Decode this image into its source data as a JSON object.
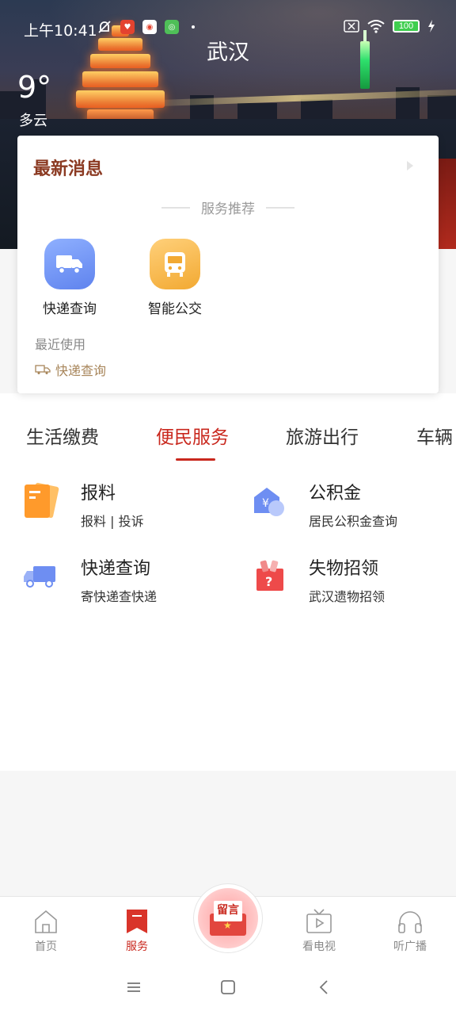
{
  "status_bar": {
    "time": "上午10:41",
    "battery": "100"
  },
  "header": {
    "city": "武汉",
    "temperature": "9°",
    "weather": "多云"
  },
  "news_card": {
    "title": "最新消息",
    "section_label": "服务推荐",
    "quick_services": [
      {
        "label": "快递查询",
        "icon": "truck-icon",
        "color": "#6f93f5"
      },
      {
        "label": "智能公交",
        "icon": "bus-icon",
        "color": "#f4b440"
      }
    ],
    "recent_label": "最近使用",
    "recent_item": "快递查询"
  },
  "tabs": [
    "生活缴费",
    "便民服务",
    "旅游出行",
    "车辆"
  ],
  "active_tab": "便民服务",
  "services": [
    {
      "name": "报料",
      "desc": "报料 | 投诉",
      "icon": "report-icon"
    },
    {
      "name": "公积金",
      "desc": "居民公积金查询",
      "icon": "housing-fund-icon"
    },
    {
      "name": "快递查询",
      "desc": "寄快递查快递",
      "icon": "truck-icon"
    },
    {
      "name": "失物招领",
      "desc": "武汉遗物招领",
      "icon": "lost-found-icon"
    }
  ],
  "bottom_nav": [
    {
      "label": "首页",
      "icon": "home-icon"
    },
    {
      "label": "服务",
      "icon": "bookmark-icon"
    },
    {
      "label": "留言",
      "icon": "message-envelope-icon"
    },
    {
      "label": "看电视",
      "icon": "tv-icon"
    },
    {
      "label": "听广播",
      "icon": "headphones-icon"
    }
  ],
  "colors": {
    "accent": "#c9281e",
    "news_title": "#8b3a22",
    "recent_item": "#a8865b"
  }
}
